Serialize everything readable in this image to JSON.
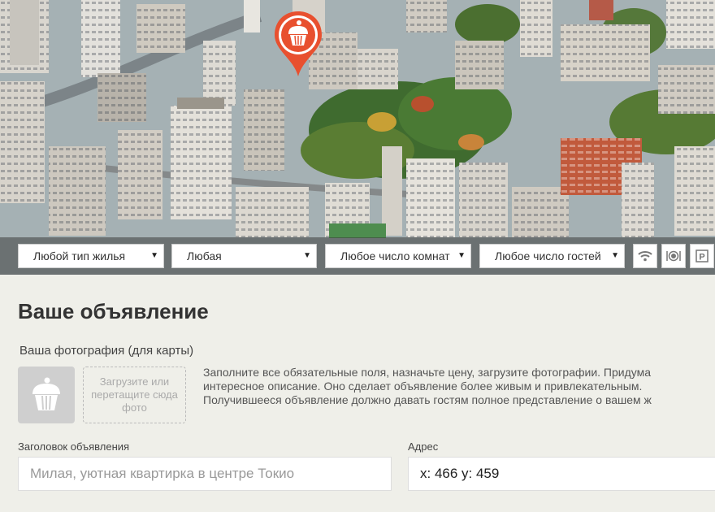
{
  "filters": {
    "housing_type": "Любой тип жилья",
    "price": "Любая",
    "rooms": "Любое число комнат",
    "guests": "Любое число гостей",
    "arrow": "▼",
    "icons": [
      "wifi-icon",
      "food-icon",
      "parking-icon"
    ]
  },
  "pin": {
    "icon": "cupcake-icon",
    "color": "#e8502f"
  },
  "form": {
    "title": "Ваше объявление",
    "photo_label": "Ваша фотография (для карты)",
    "dropzone_text": "Загрузите или перетащите сюда фото",
    "description": [
      "Заполните все обязательные поля, назначьте цену, загрузите фотографии. Придума",
      "интересное описание. Оно сделает объявление более живым и привлекательным.",
      "Получившееся объявление должно давать гостям полное представление о вашем ж"
    ],
    "title_field_label": "Заголовок объявления",
    "title_field_placeholder": "Милая, уютная квартирка в центре Токио",
    "address_label": "Адрес",
    "address_value": "x: 466 y: 459"
  }
}
